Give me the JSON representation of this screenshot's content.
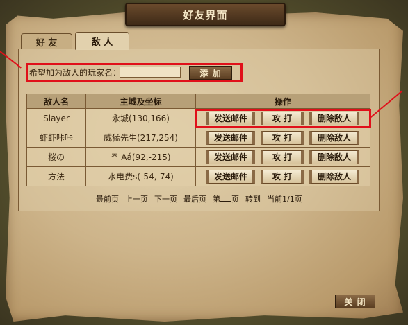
{
  "window": {
    "title": "好友界面"
  },
  "tabs": [
    {
      "label": "好 友",
      "active": false
    },
    {
      "label": "敌 人",
      "active": true
    }
  ],
  "add_enemy": {
    "label": "希望加为敌人的玩家名：",
    "input_value": "",
    "button": "添 加"
  },
  "table": {
    "headers": [
      "敌人名",
      "主城及坐标",
      "操作"
    ],
    "rows": [
      {
        "name": "Slayer",
        "city": "永城(130,166)"
      },
      {
        "name": "虾虾咔咔",
        "city": "威猛先生(217,254)"
      },
      {
        "name": "桜の",
        "city": "ᅎ Aá(92,-215)"
      },
      {
        "name": "方法",
        "city": "水电费s(-54,-74)"
      }
    ],
    "actions": {
      "mail": "发送邮件",
      "attack": "攻 打",
      "delete": "删除敌人"
    }
  },
  "pager": {
    "first": "最前页",
    "prev": "上一页",
    "next": "下一页",
    "last": "最后页",
    "goto_prefix": "第",
    "goto_suffix": "页",
    "goto": "转到",
    "current": "当前1/1页"
  },
  "close_button": "关 闭",
  "colors": {
    "highlight": "#e0101a",
    "parchment": "#cdb48a",
    "banner": "#4e351e"
  }
}
